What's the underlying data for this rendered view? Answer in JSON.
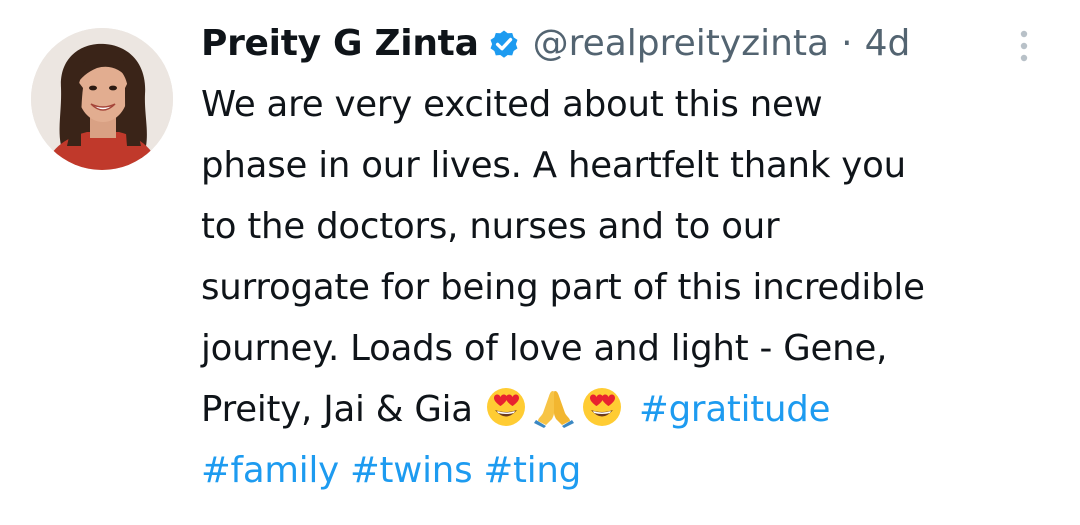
{
  "tweet": {
    "author_name": "Preity G Zinta",
    "handle": "@realpreityzinta",
    "separator": "·",
    "time": "4d",
    "lines": [
      "We are very excited about this new",
      "phase in our lives. A heartfelt thank you",
      "to the doctors, nurses and to our",
      "surrogate for being part of this incredible",
      "journey. Loads of love and light - Gene,"
    ],
    "last_line_text": "Preity, Jai & Gia ",
    "emojis": [
      "heart-eyes-face",
      "folded-hands",
      "heart-eyes-face"
    ],
    "hashtags": [
      "#gratitude",
      "#family",
      "#twins",
      "#ting"
    ],
    "verified": true
  },
  "colors": {
    "text": "#0f1419",
    "secondary": "#536471",
    "link": "#1d9bf0",
    "verified": "#1d9bf0"
  },
  "icons": {
    "verified": "verified-badge-icon",
    "more": "more-vertical-icon"
  }
}
